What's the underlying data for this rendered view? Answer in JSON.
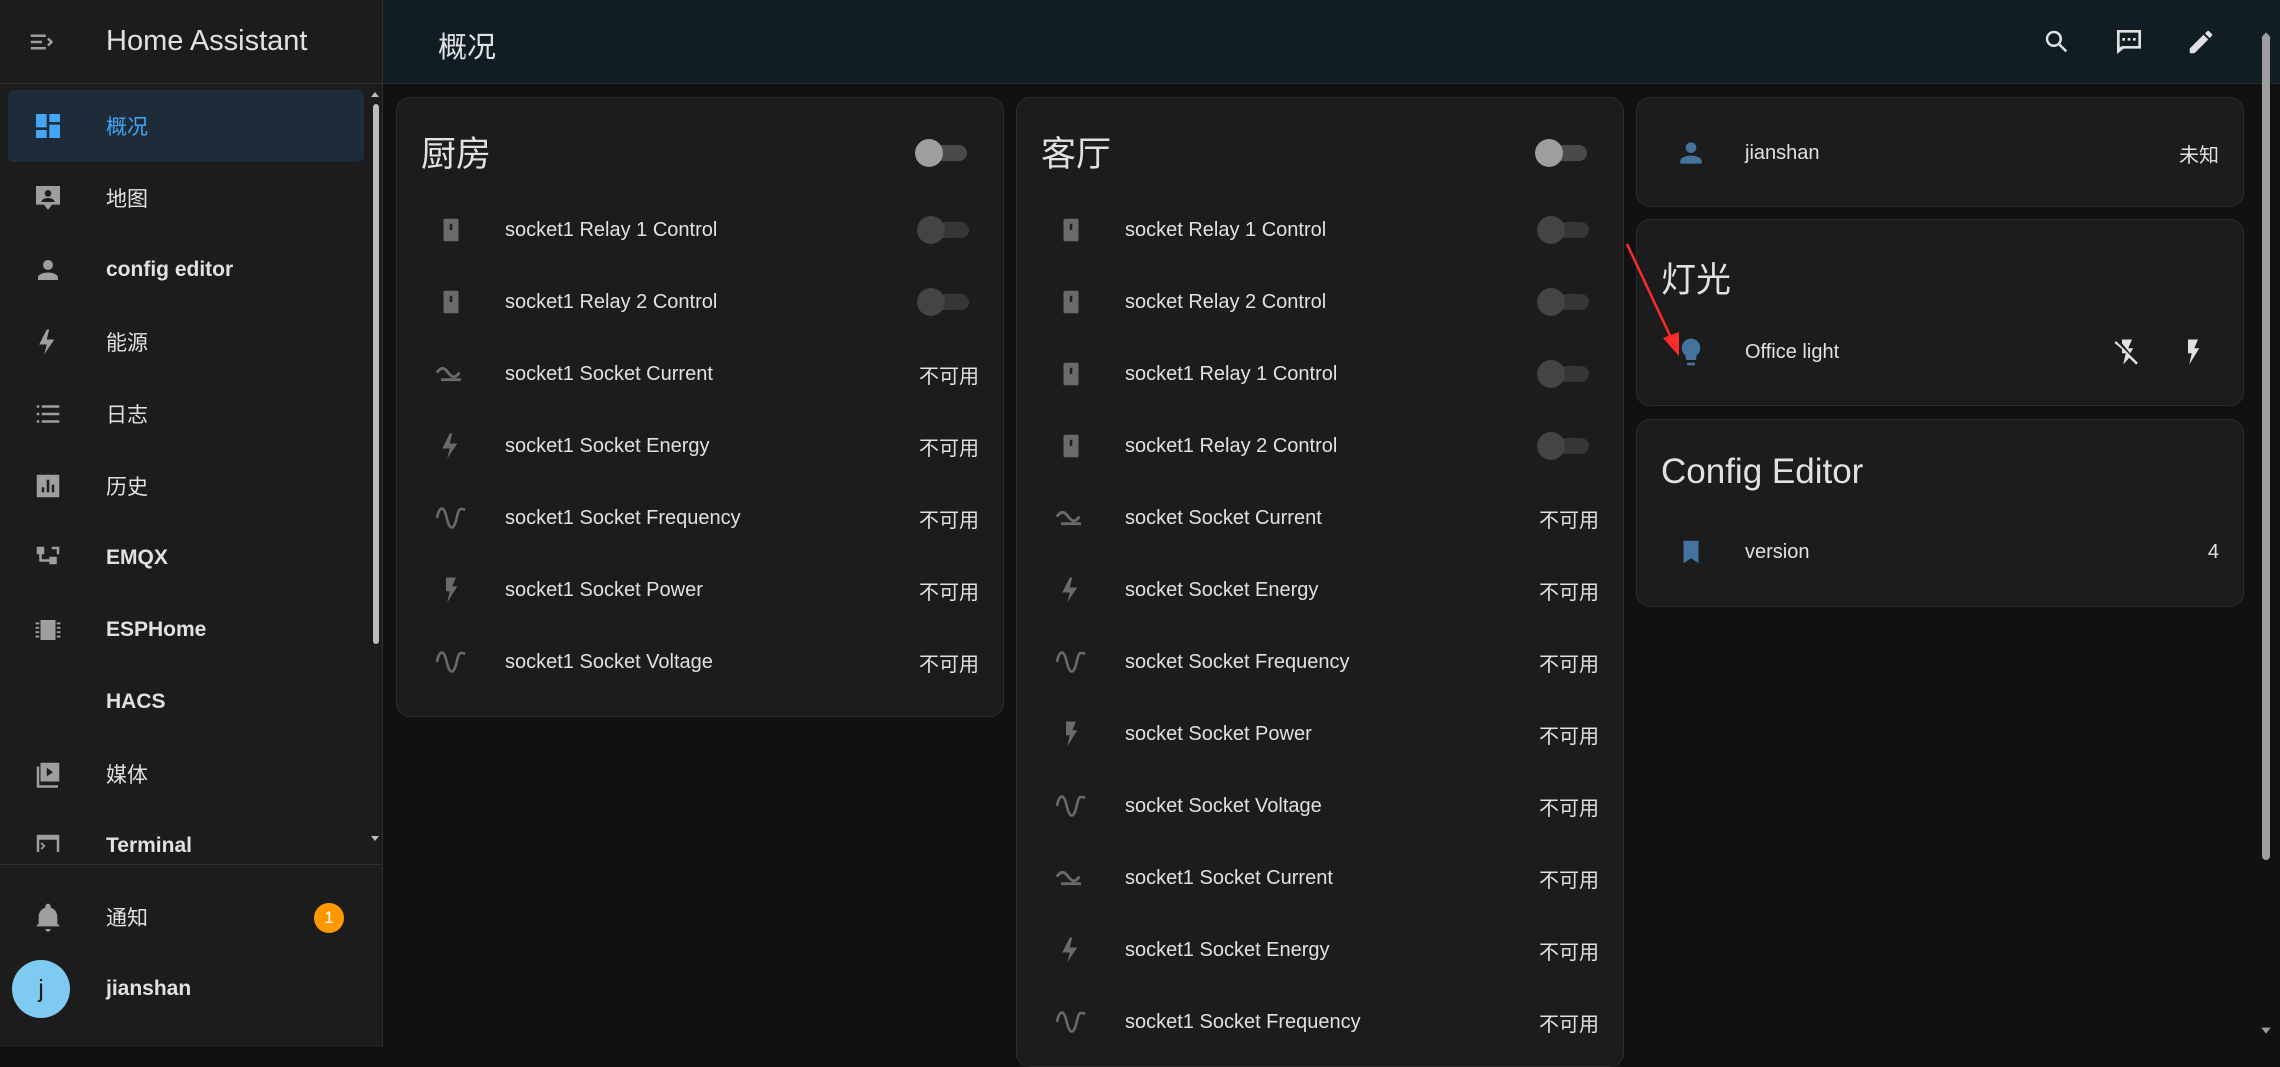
{
  "app": {
    "title": "Home Assistant"
  },
  "topbar": {
    "title": "概况"
  },
  "sidebar": {
    "items": [
      {
        "label": "概况",
        "icon": "dashboard-icon",
        "active": true
      },
      {
        "label": "地图",
        "icon": "map-account-icon"
      },
      {
        "label": "config editor",
        "icon": "account-icon"
      },
      {
        "label": "能源",
        "icon": "lightning-icon"
      },
      {
        "label": "日志",
        "icon": "format-list-icon"
      },
      {
        "label": "历史",
        "icon": "chart-box-icon"
      },
      {
        "label": "EMQX",
        "icon": "lan-connect-icon"
      },
      {
        "label": "ESPHome",
        "icon": "chip-icon"
      },
      {
        "label": "HACS",
        "icon": "hacs-icon"
      },
      {
        "label": "媒体",
        "icon": "play-box-icon"
      },
      {
        "label": "Terminal",
        "icon": "console-icon"
      }
    ],
    "notifications": {
      "label": "通知",
      "count": "1"
    },
    "user": {
      "initial": "j",
      "name": "jianshan"
    }
  },
  "cards": {
    "kitchen": {
      "title": "厨房",
      "rows": [
        {
          "name": "socket1 Relay 1 Control",
          "type": "toggle"
        },
        {
          "name": "socket1 Relay 2 Control",
          "type": "toggle"
        },
        {
          "name": "socket1 Socket Current",
          "state": "不可用",
          "icon": "current-ac-icon"
        },
        {
          "name": "socket1 Socket Energy",
          "state": "不可用",
          "icon": "lightning-icon"
        },
        {
          "name": "socket1 Socket Frequency",
          "state": "不可用",
          "icon": "sine-wave-icon"
        },
        {
          "name": "socket1 Socket Power",
          "state": "不可用",
          "icon": "flash-icon"
        },
        {
          "name": "socket1 Socket Voltage",
          "state": "不可用",
          "icon": "sine-wave-icon"
        }
      ]
    },
    "living": {
      "title": "客厅",
      "rows": [
        {
          "name": "socket Relay 1 Control",
          "type": "toggle"
        },
        {
          "name": "socket Relay 2 Control",
          "type": "toggle"
        },
        {
          "name": "socket1 Relay 1 Control",
          "type": "toggle"
        },
        {
          "name": "socket1 Relay 2 Control",
          "type": "toggle"
        },
        {
          "name": "socket Socket Current",
          "state": "不可用",
          "icon": "current-ac-icon"
        },
        {
          "name": "socket Socket Energy",
          "state": "不可用",
          "icon": "lightning-icon"
        },
        {
          "name": "socket Socket Frequency",
          "state": "不可用",
          "icon": "sine-wave-icon"
        },
        {
          "name": "socket Socket Power",
          "state": "不可用",
          "icon": "flash-icon"
        },
        {
          "name": "socket Socket Voltage",
          "state": "不可用",
          "icon": "sine-wave-icon"
        },
        {
          "name": "socket1 Socket Current",
          "state": "不可用",
          "icon": "current-ac-icon"
        },
        {
          "name": "socket1 Socket Energy",
          "state": "不可用",
          "icon": "lightning-icon"
        },
        {
          "name": "socket1 Socket Frequency",
          "state": "不可用",
          "icon": "sine-wave-icon"
        }
      ]
    },
    "person": {
      "name": "jianshan",
      "state": "未知"
    },
    "lights": {
      "title": "灯光",
      "name": "Office light"
    },
    "config": {
      "title": "Config Editor",
      "name": "version",
      "value": "4"
    }
  },
  "colors": {
    "accent": "#42a5f5",
    "icon": "#6a6a6a",
    "icon_blue": "#44739e",
    "badge": "#ff9800"
  }
}
